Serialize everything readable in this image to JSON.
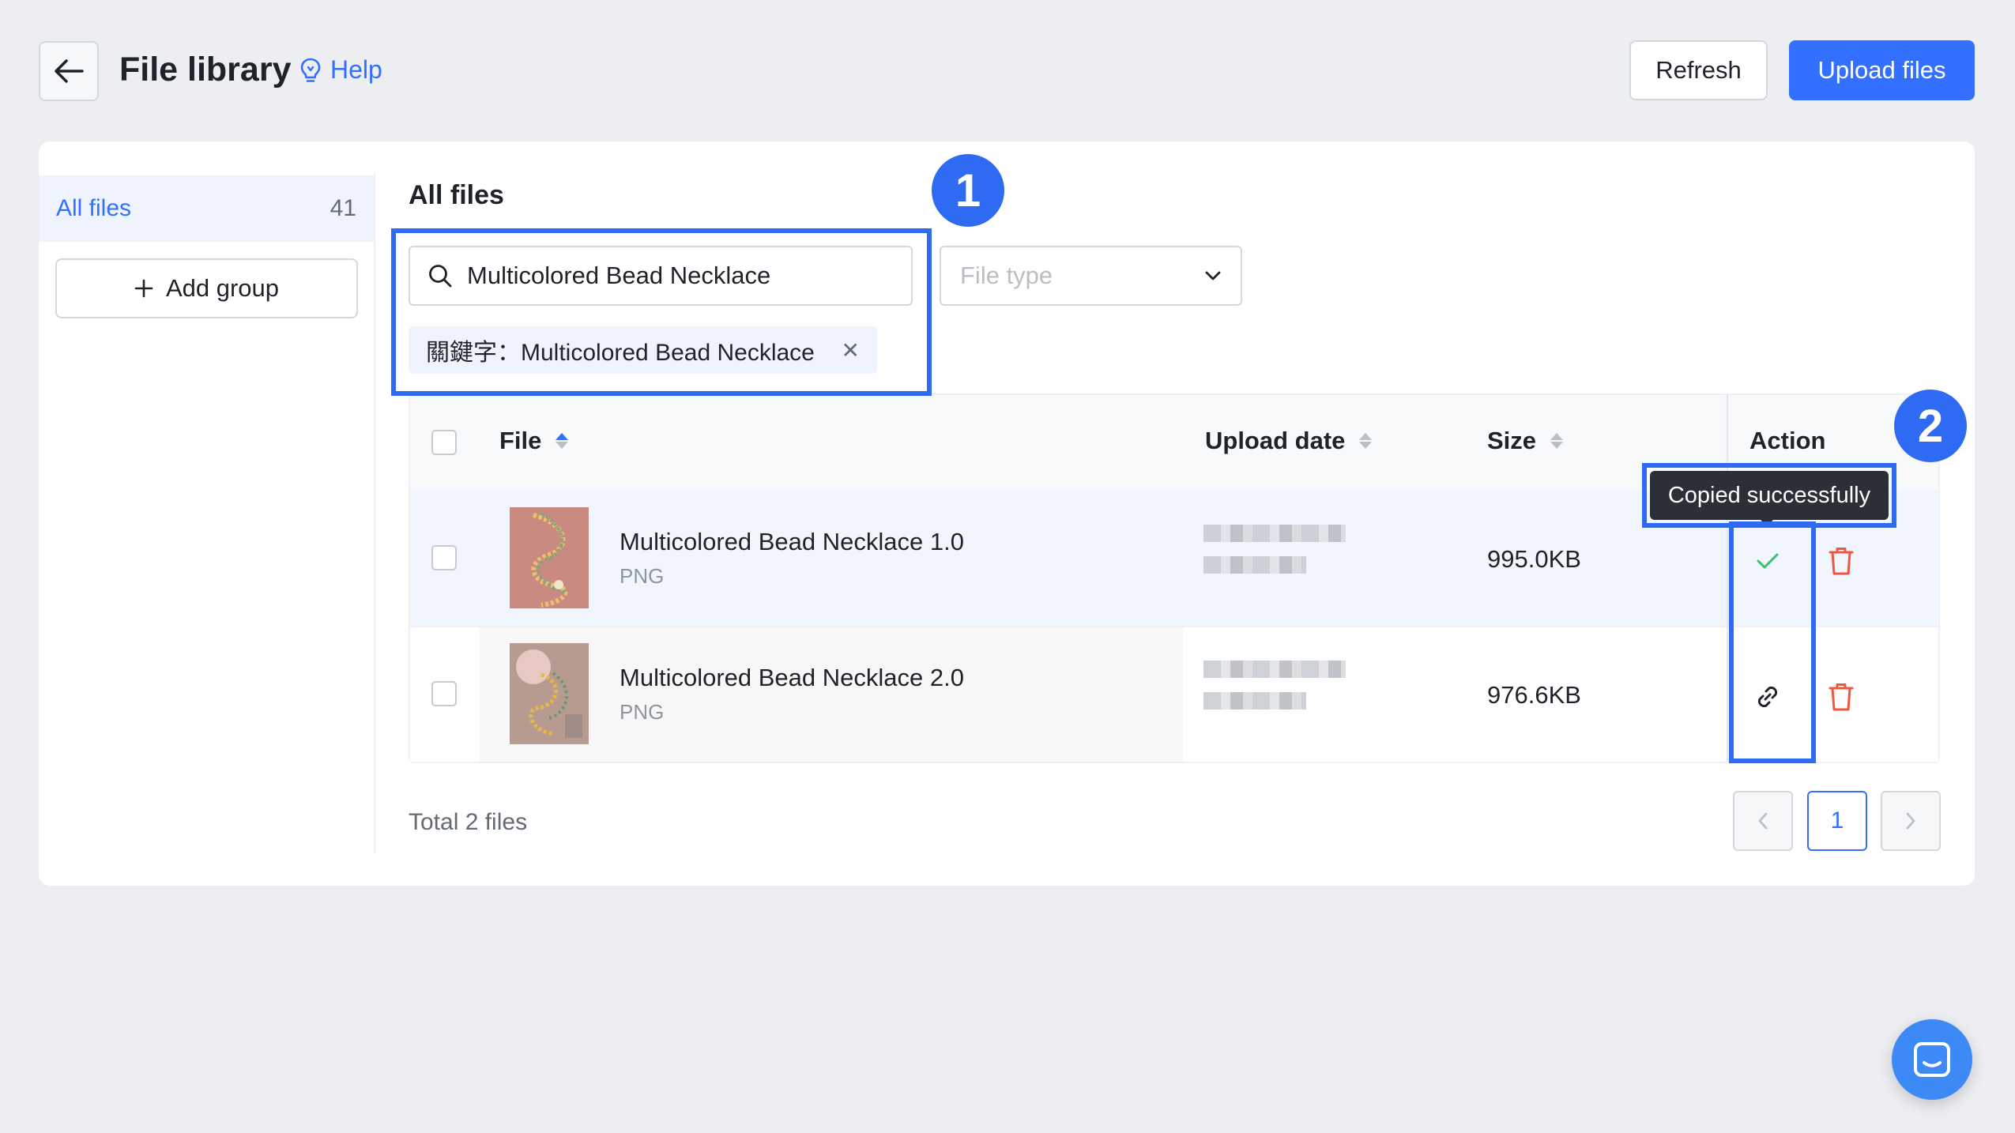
{
  "header": {
    "title": "File library",
    "help_label": "Help",
    "refresh_label": "Refresh",
    "upload_label": "Upload files"
  },
  "sidebar": {
    "all_files_label": "All files",
    "all_files_count": "41",
    "add_group_label": "Add group"
  },
  "main": {
    "section_title": "All files",
    "search_value": "Multicolored Bead Necklace",
    "filter_tag": "關鍵字：Multicolored Bead Necklace",
    "file_type_placeholder": "File type"
  },
  "annotations": {
    "badge_1": "1",
    "badge_2": "2"
  },
  "table": {
    "columns": {
      "file": "File",
      "upload_date": "Upload date",
      "size": "Size",
      "action": "Action"
    },
    "rows": [
      {
        "name": "Multicolored Bead Necklace 1.0",
        "type": "PNG",
        "size": "995.0KB"
      },
      {
        "name": "Multicolored Bead Necklace 2.0",
        "type": "PNG",
        "size": "976.6KB"
      }
    ]
  },
  "tooltip": "Copied successfully",
  "footer": {
    "total": "Total 2 files",
    "current_page": "1"
  },
  "colors": {
    "accent": "#3370ff",
    "highlight": "#2f6bf2",
    "delete": "#f0573f",
    "success": "#34c26b"
  }
}
